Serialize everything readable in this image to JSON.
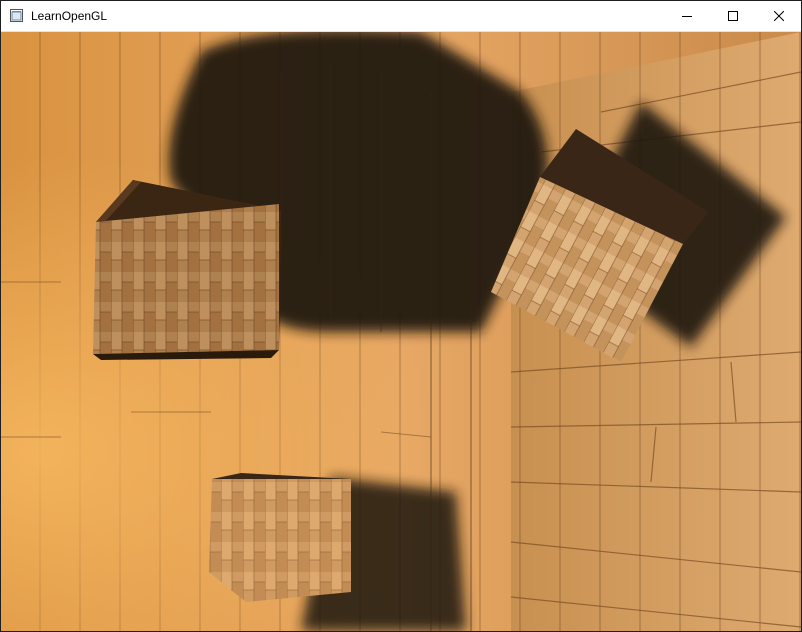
{
  "window": {
    "title": "LearnOpenGL",
    "app_icon": "opengl-window-icon",
    "controls": [
      {
        "name": "minimize-button",
        "icon": "minimize-icon"
      },
      {
        "name": "maximize-button",
        "icon": "maximize-icon"
      },
      {
        "name": "close-button",
        "icon": "close-icon"
      }
    ]
  },
  "scene": {
    "description_icon": "3d-render-viewport",
    "colors": {
      "wood_light": "#e0a865",
      "wood_mid": "#c48a4a",
      "wood_dark": "#8a5a2c",
      "shadow": "#1e1208",
      "cube_top": "#3a2616"
    }
  }
}
